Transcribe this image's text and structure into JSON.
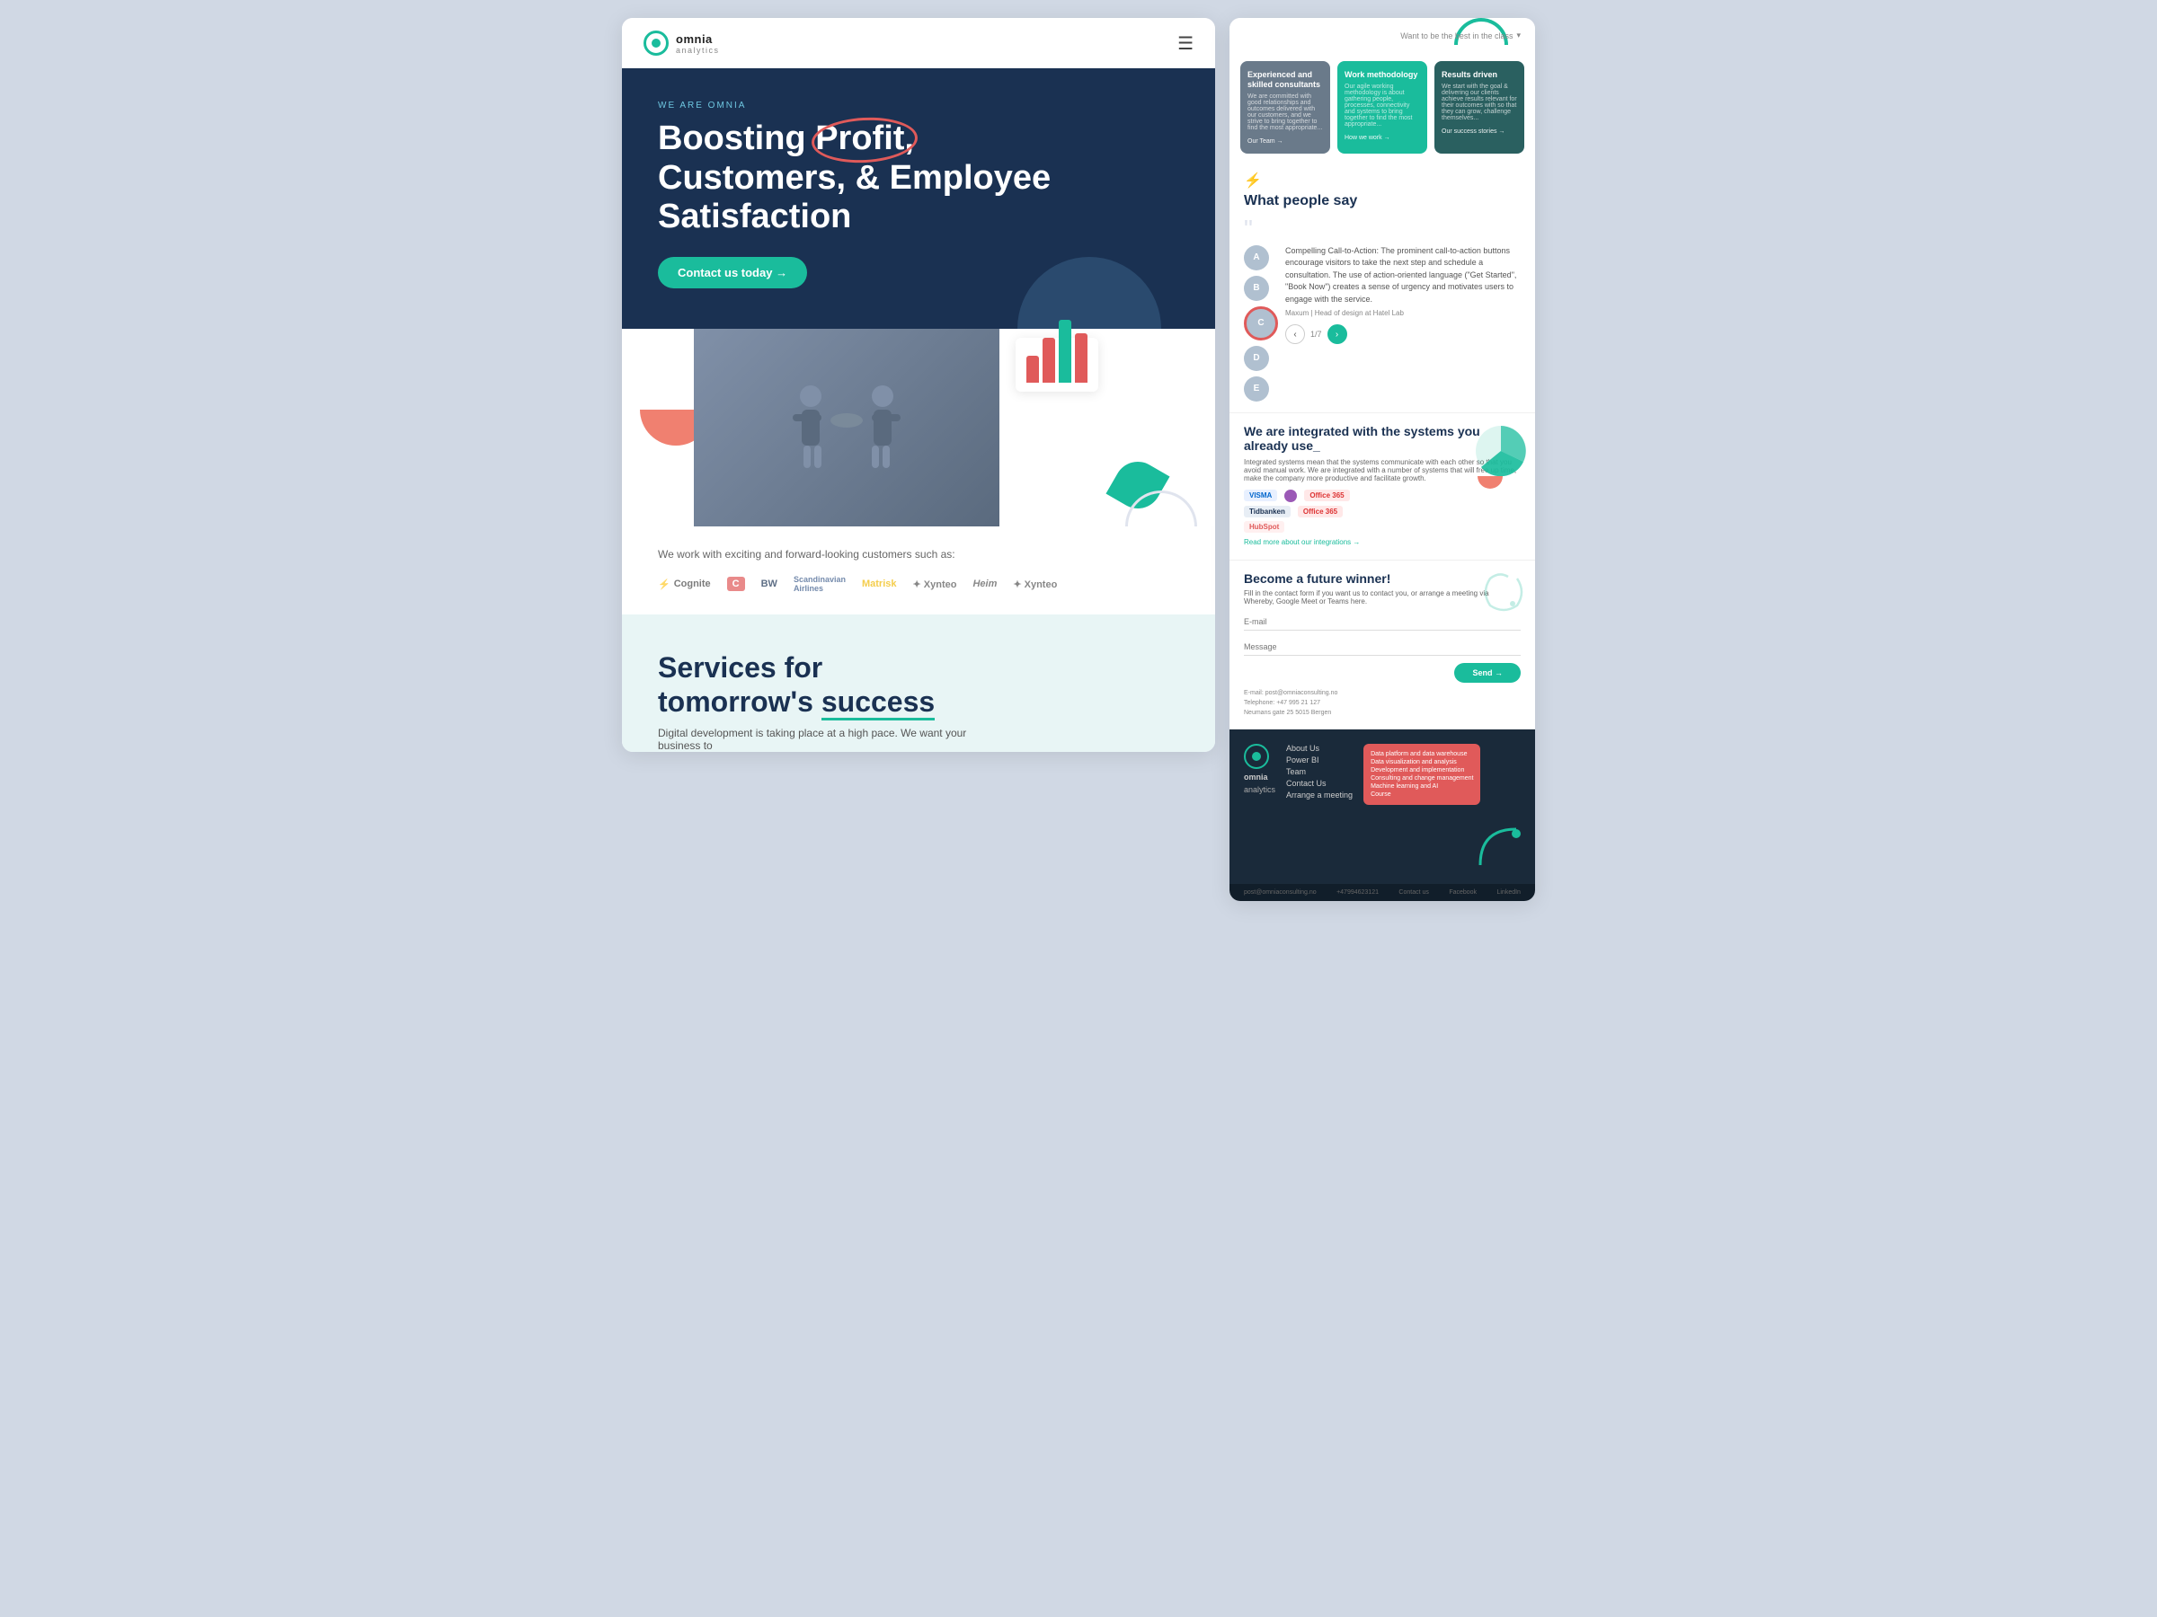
{
  "brand": {
    "name": "omnia",
    "sub": "analytics",
    "logo_alt": "Omnia Analytics logo"
  },
  "nav": {
    "hamburger_icon": "☰"
  },
  "hero": {
    "label": "WE ARE OMNIA",
    "title_line1": "Boosting ",
    "title_highlight": "Profit,",
    "title_line2": "Customers, & Employee",
    "title_line3": "Satisfaction",
    "cta_button": "Contact us today →"
  },
  "chart": {
    "bars": [
      30,
      50,
      70,
      55
    ]
  },
  "clients": {
    "label": "We work with exciting and forward-looking customers such as:",
    "logos": [
      "Cognite",
      "C",
      "BW",
      "Scandinavian",
      "Matrisk",
      "Xynteo",
      "Heim",
      "Xynteo"
    ]
  },
  "services_teaser": {
    "title_line1": "Services for",
    "title_line2": "tomorrow's ",
    "title_highlight": "success",
    "description": "Digital development is taking place at a high pace. We want your business to"
  },
  "right_panel": {
    "dropdown_label": "Want to be the best in the class",
    "cards": [
      {
        "title": "Experienced and skilled consultants",
        "desc": "We are committed with good relationships and outcomes delivered with our customers, and we strive to bring together to find the most appropriate...",
        "link": "Our Team →"
      },
      {
        "title": "Work methodology",
        "desc": "Our agile working methodology is about gathering people, processes, connectivity and systems to bring together to find the most appropriate...",
        "link": "How we work →"
      },
      {
        "title": "Results driven",
        "desc": "We start with the goal & delivering our clients achieve results relevant for their outcomes with so that they can grow, challenge themselves...",
        "link": "Our success stories →"
      }
    ],
    "testimonials": {
      "section_heading": "What people say",
      "quote_text": "Compelling Call-to-Action: The prominent call-to-action buttons encourage visitors to take the next step and schedule a consultation. The use of action-oriented language (\"Get Started\", \"Book Now\") creates a sense of urgency and motivates users to engage with the service.",
      "author": "Maxum | Head of design at Hatel Lab",
      "nav_count": "1/7",
      "avatars": [
        "A",
        "B",
        "C",
        "D",
        "E"
      ]
    },
    "integrations": {
      "title": "We are integrated with the systems you already use_",
      "description": "Integrated systems mean that the systems communicate with each other so that you avoid manual work. We are integrated with a number of systems that will free up time, make the company more productive and facilitate growth.",
      "logos": [
        "VISMA",
        "Office 365",
        "Tidbanken",
        "HubSpot",
        "Office 365"
      ],
      "link": "Read more about our integrations →"
    },
    "contact": {
      "title": "Become a future winner!",
      "description": "Fill in the contact form if you want us to contact you, or arrange a meeting via Whereby, Google Meet or Teams here.",
      "email_placeholder": "E-mail",
      "message_placeholder": "Message",
      "send_button": "Send →",
      "contact_info_email": "E-mail: post@omniaconsulting.no",
      "contact_info_phone": "Telephone: +47 995 21 127",
      "contact_info_address": "Neumans gate 25 5015 Bergen"
    },
    "footer": {
      "nav_links": [
        "About Us",
        "Power BI",
        "Team",
        "Contact Us",
        "Arrange a meeting"
      ],
      "services": [
        "Data platform and data warehouse",
        "Data visualization and analysis",
        "Development and implementation",
        "Consulting and change management",
        "Machine learning and AI",
        "Course"
      ],
      "bottom": {
        "email": "post@omniaconsulting.no",
        "phone": "+47994623121",
        "contact": "Contact us",
        "facebook": "Facebook",
        "linkedin": "LinkedIn"
      }
    }
  }
}
